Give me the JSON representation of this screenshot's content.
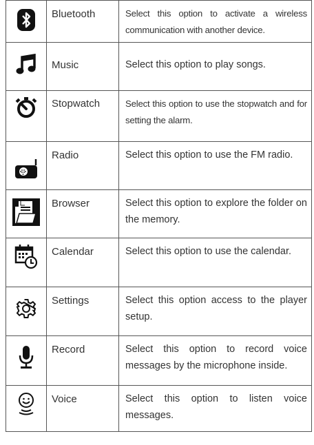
{
  "rows": [
    {
      "icon": "bluetooth-icon",
      "name": "Bluetooth",
      "desc": "Select this option to activate a wireless communication with another device."
    },
    {
      "icon": "music-note-icon",
      "name": "Music",
      "desc": "Select this option to play songs."
    },
    {
      "icon": "stopwatch-icon",
      "name": "Stopwatch",
      "desc": "Select this option to use the stopwatch and for setting the alarm."
    },
    {
      "icon": "radio-icon",
      "name": "Radio",
      "desc": "Select this option to use the FM radio."
    },
    {
      "icon": "folder-browser-icon",
      "name": "Browser",
      "desc": "Select this option to explore the folder on the memory."
    },
    {
      "icon": "calendar-clock-icon",
      "name": "Calendar",
      "desc": "Select this option to use the calendar."
    },
    {
      "icon": "gear-icon",
      "name": "Settings",
      "desc": "Select this option access to the player setup."
    },
    {
      "icon": "microphone-icon",
      "name": "Record",
      "desc": "Select this option to record voice messages by the microphone inside."
    },
    {
      "icon": "voice-face-icon",
      "name": "Voice",
      "desc": "Select this option to listen voice messages."
    }
  ]
}
